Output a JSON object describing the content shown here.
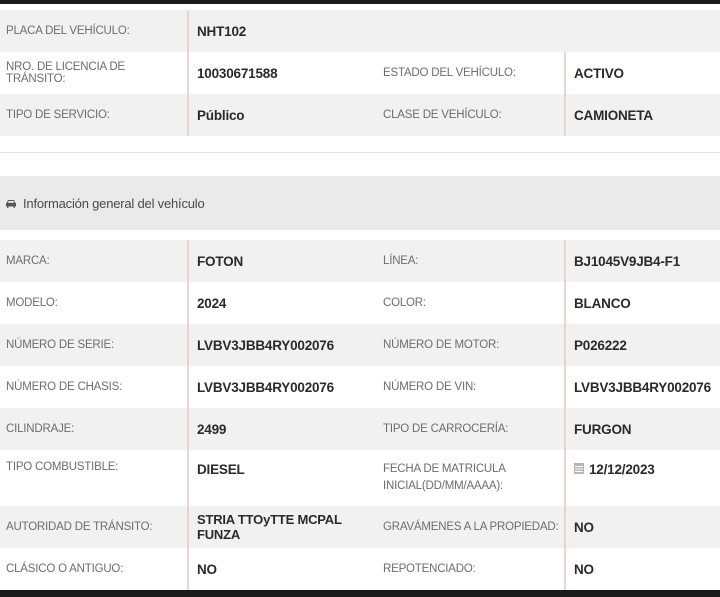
{
  "top_rows": [
    {
      "l1": "PLACA DEL VEHÍCULO:",
      "v1": "NHT102"
    },
    {
      "l1": "NRO. DE LICENCIA DE TRÁNSITO:",
      "v1": "10030671588",
      "l2": "ESTADO DEL VEHÍCULO:",
      "v2": "ACTIVO"
    },
    {
      "l1": "TIPO DE SERVICIO:",
      "v1": "Público",
      "l2": "CLASE DE VEHÍCULO:",
      "v2": "CAMIONETA"
    }
  ],
  "section": {
    "title": "Información general del vehículo",
    "icon": "car-icon"
  },
  "info_rows": [
    {
      "l1": "MARCA:",
      "v1": "FOTON",
      "l2": "LÍNEA:",
      "v2": "BJ1045V9JB4-F1"
    },
    {
      "l1": "MODELO:",
      "v1": "2024",
      "l2": "COLOR:",
      "v2": "BLANCO"
    },
    {
      "l1": "NÚMERO DE SERIE:",
      "v1": "LVBV3JBB4RY002076",
      "l2": "NÚMERO DE MOTOR:",
      "v2": "P026222"
    },
    {
      "l1": "NÚMERO DE CHASIS:",
      "v1": "LVBV3JBB4RY002076",
      "l2": "NÚMERO DE VIN:",
      "v2": "LVBV3JBB4RY002076"
    },
    {
      "l1": "CILINDRAJE:",
      "v1": "2499",
      "l2": "TIPO DE CARROCERÍA:",
      "v2": "FURGON"
    },
    {
      "l1": "TIPO COMBUSTIBLE:",
      "v1": "DIESEL",
      "l2a": "FECHA DE MATRICULA",
      "l2b": "INICIAL(DD/MM/AAAA):",
      "v2": "12/12/2023",
      "icon": "calendar-icon"
    },
    {
      "l1": "AUTORIDAD DE TRÁNSITO:",
      "v1": "STRIA TTOyTTE MCPAL FUNZA",
      "l2": "GRAVÁMENES A LA PROPIEDAD:",
      "v2": "NO"
    },
    {
      "l1": "CLÁSICO O ANTIGUO:",
      "v1": "NO",
      "l2": "REPOTENCIADO:",
      "v2": "NO"
    }
  ]
}
